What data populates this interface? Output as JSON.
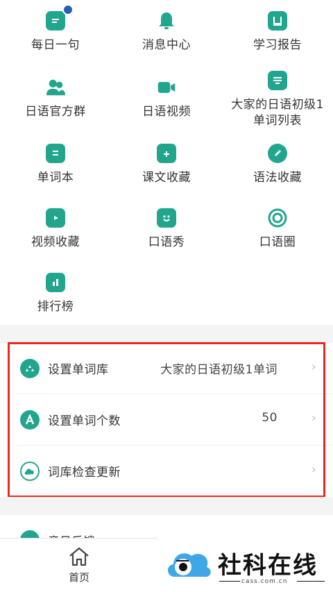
{
  "colors": {
    "accent": "#21a68d",
    "highlight_border": "#e8291d",
    "badge": "#2a5fb5"
  },
  "grid_items": [
    {
      "label": "每日一句",
      "icon": "chat-bubble-icon",
      "glyph": "≡"
    },
    {
      "label": "消息中心",
      "icon": "bell-icon",
      "glyph": ""
    },
    {
      "label": "学习报告",
      "icon": "report-book-icon",
      "glyph": ""
    },
    {
      "label": "日语官方群",
      "icon": "group-people-icon",
      "glyph": ""
    },
    {
      "label": "日语视频",
      "icon": "video-camera-icon",
      "glyph": ""
    },
    {
      "label": "大家的日语初级1单词列表",
      "icon": "list-icon",
      "glyph": "≡"
    },
    {
      "label": "单词本",
      "icon": "notebook-icon",
      "glyph": "≡"
    },
    {
      "label": "课文收藏",
      "icon": "calendar-plus-icon",
      "glyph": "+"
    },
    {
      "label": "语法收藏",
      "icon": "pencil-badge-icon",
      "glyph": "✎"
    },
    {
      "label": "视频收藏",
      "icon": "play-video-icon",
      "glyph": "▶"
    },
    {
      "label": "口语秀",
      "icon": "smile-face-icon",
      "glyph": "☺"
    },
    {
      "label": "口语圈",
      "icon": "circle-ring-icon",
      "glyph": ""
    },
    {
      "label": "排行榜",
      "icon": "bar-chart-icon",
      "glyph": "▮▮"
    }
  ],
  "settings": {
    "word_bank": {
      "label": "设置单词库",
      "value": "大家的日语初级1单词",
      "icon": "triangle-dots-icon"
    },
    "word_count": {
      "label": "设置单词个数",
      "value": "50",
      "icon": "letter-a-icon"
    },
    "check_update": {
      "label": "词库检查更新",
      "icon": "cloud-refresh-icon"
    }
  },
  "feedback_row": {
    "label": "意见反馈",
    "icon": "feedback-icon"
  },
  "tabbar": {
    "home_label": "首页",
    "home_icon": "home-icon"
  },
  "watermark": {
    "title": "社科在线",
    "domain": "cass.com.cn"
  }
}
